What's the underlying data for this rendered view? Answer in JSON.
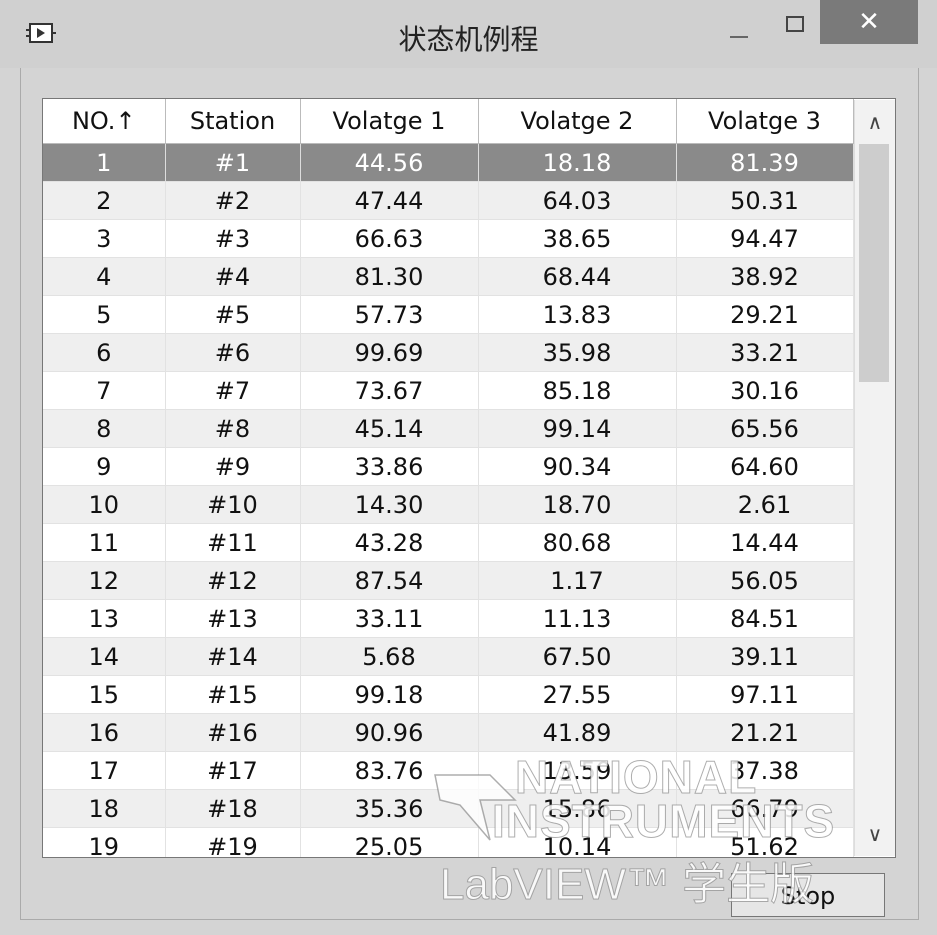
{
  "window": {
    "title": "状态机例程",
    "close_glyph": "✕",
    "icons": [
      "app-icon",
      "minimize-icon",
      "maximize-icon",
      "close-icon"
    ]
  },
  "table": {
    "columns": [
      "NO.↑",
      "Station",
      "Volatge 1",
      "Volatge 2",
      "Volatge 3"
    ],
    "selected_row": 0,
    "rows": [
      [
        "1",
        "#1",
        "44.56",
        "18.18",
        "81.39"
      ],
      [
        "2",
        "#2",
        "47.44",
        "64.03",
        "50.31"
      ],
      [
        "3",
        "#3",
        "66.63",
        "38.65",
        "94.47"
      ],
      [
        "4",
        "#4",
        "81.30",
        "68.44",
        "38.92"
      ],
      [
        "5",
        "#5",
        "57.73",
        "13.83",
        "29.21"
      ],
      [
        "6",
        "#6",
        "99.69",
        "35.98",
        "33.21"
      ],
      [
        "7",
        "#7",
        "73.67",
        "85.18",
        "30.16"
      ],
      [
        "8",
        "#8",
        "45.14",
        "99.14",
        "65.56"
      ],
      [
        "9",
        "#9",
        "33.86",
        "90.34",
        "64.60"
      ],
      [
        "10",
        "#10",
        "14.30",
        "18.70",
        "2.61"
      ],
      [
        "11",
        "#11",
        "43.28",
        "80.68",
        "14.44"
      ],
      [
        "12",
        "#12",
        "87.54",
        "1.17",
        "56.05"
      ],
      [
        "13",
        "#13",
        "33.11",
        "11.13",
        "84.51"
      ],
      [
        "14",
        "#14",
        "5.68",
        "67.50",
        "39.11"
      ],
      [
        "15",
        "#15",
        "99.18",
        "27.55",
        "97.11"
      ],
      [
        "16",
        "#16",
        "90.96",
        "41.89",
        "21.21"
      ],
      [
        "17",
        "#17",
        "83.76",
        "13.59",
        "37.38"
      ],
      [
        "18",
        "#18",
        "35.36",
        "15.86",
        "66.79"
      ],
      [
        "19",
        "#19",
        "25.05",
        "10.14",
        "51.62"
      ]
    ],
    "scroll_up_glyph": "∧",
    "scroll_down_glyph": "∨"
  },
  "stop_button": {
    "label": "Stop"
  },
  "watermark": {
    "line1": "NATIONAL",
    "line2": "INSTRUMENTS",
    "line3": "LabVIEW™ 学生版"
  },
  "colors": {
    "selected_row": "#8a8a8a",
    "close_button": "#7a7a7a",
    "window_bg": "#d4d4d4"
  }
}
